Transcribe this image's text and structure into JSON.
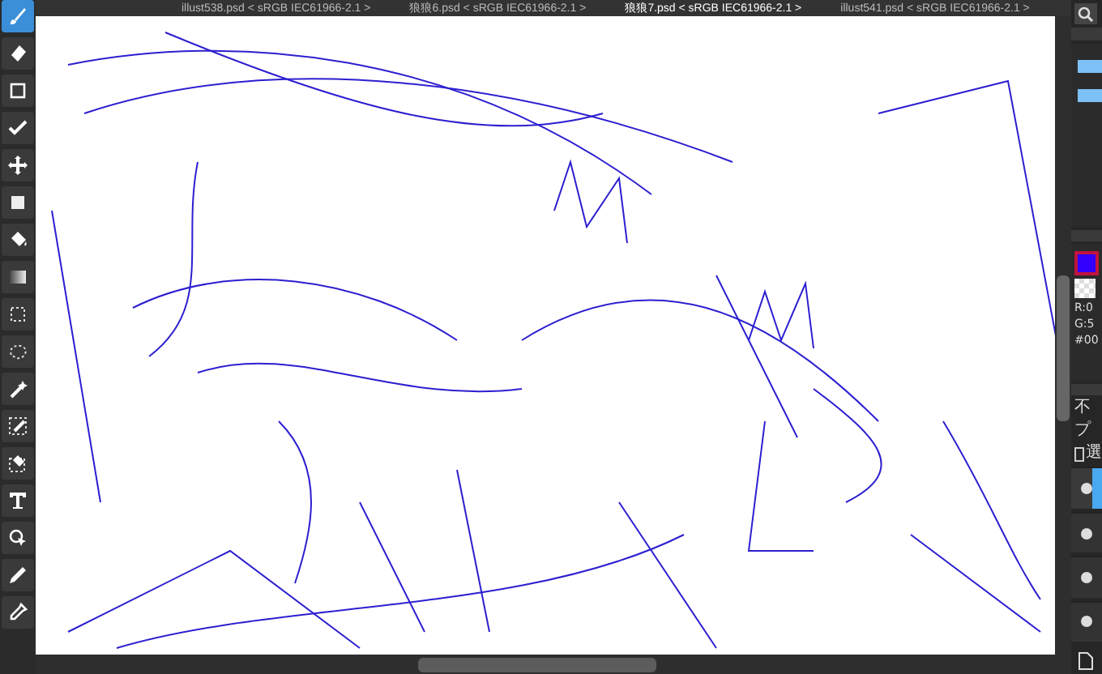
{
  "tabs": [
    {
      "label": "illust538.psd < sRGB IEC61966-2.1 >",
      "selected": false
    },
    {
      "label": "狼狼6.psd < sRGB IEC61966-2.1 >",
      "selected": false
    },
    {
      "label": "狼狼7.psd < sRGB IEC61966-2.1 >",
      "selected": true
    },
    {
      "label": "illust541.psd < sRGB IEC61966-2.1 >",
      "selected": false
    }
  ],
  "tools": [
    {
      "kind": "brush",
      "selected": true
    },
    {
      "kind": "eraser",
      "selected": false
    },
    {
      "kind": "rect",
      "selected": false
    },
    {
      "kind": "check",
      "selected": false
    },
    {
      "kind": "move",
      "selected": false
    },
    {
      "kind": "fill",
      "selected": false
    },
    {
      "kind": "bucket",
      "selected": false
    },
    {
      "kind": "gradient",
      "selected": false
    },
    {
      "kind": "select",
      "selected": false
    },
    {
      "kind": "lasso",
      "selected": false
    },
    {
      "kind": "wand",
      "selected": false
    },
    {
      "kind": "selpen",
      "selected": false
    },
    {
      "kind": "selerase",
      "selected": false
    },
    {
      "kind": "text",
      "selected": false
    },
    {
      "kind": "operation",
      "selected": false
    },
    {
      "kind": "pen",
      "selected": false
    },
    {
      "kind": "dropper",
      "selected": false
    }
  ],
  "color_panel": {
    "r": "R:0",
    "g": "G:5",
    "hex": "#00"
  },
  "layer_panel": {
    "opacity": "不",
    "blend": "プ",
    "protect": {
      "label": "選",
      "checked": false
    },
    "layers": [
      {
        "selected": true
      },
      {
        "selected": false
      },
      {
        "selected": false
      },
      {
        "selected": false
      }
    ]
  }
}
